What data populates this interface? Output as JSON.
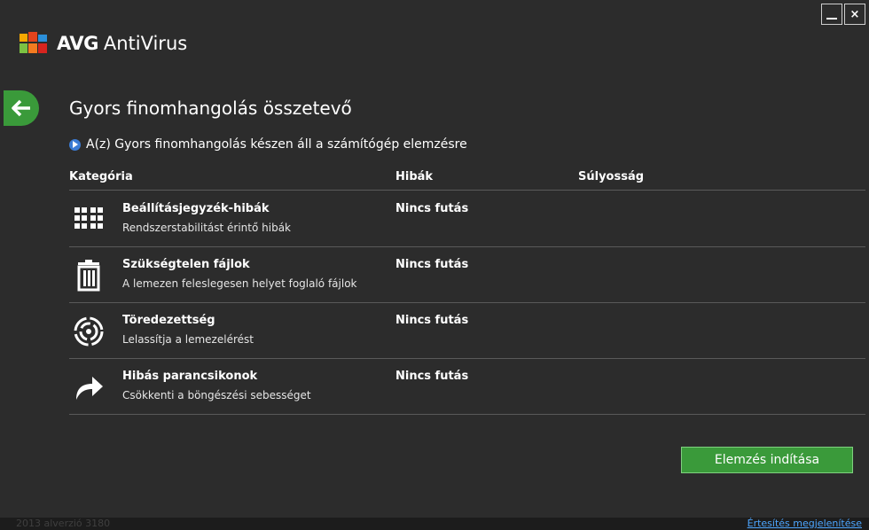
{
  "app": {
    "brand": "AVG",
    "product": "AntiVirus",
    "window_controls": {
      "minimize": "_",
      "close": "×"
    }
  },
  "page": {
    "title": "Gyors finomhangolás összetevő",
    "status": "A(z) Gyors finomhangolás készen áll a számítógép elemzésre"
  },
  "table": {
    "headers": {
      "category": "Kategória",
      "errors": "Hibák",
      "severity": "Súlyosság"
    },
    "rows": [
      {
        "icon": "registry-icon",
        "name": "Beállításjegyzék-hibák",
        "description": "Rendszerstabilitást érintő hibák",
        "errors": "Nincs futás"
      },
      {
        "icon": "trash-icon",
        "name": "Szükségtelen fájlok",
        "description": "A lemezen feleslegesen helyet foglaló fájlok",
        "errors": "Nincs futás"
      },
      {
        "icon": "fragmentation-icon",
        "name": "Töredezettség",
        "description": "Lelassítja a lemezelérést",
        "errors": "Nincs futás"
      },
      {
        "icon": "shortcut-arrow-icon",
        "name": "Hibás parancsikonok",
        "description": "Csökkenti a böngészési sebességet",
        "errors": "Nincs futás"
      }
    ]
  },
  "actions": {
    "start_scan": "Elemzés indítása"
  },
  "footer": {
    "version": "2013 alverzió 3180",
    "notification_link": "Értesítés megjelenítése"
  },
  "colors": {
    "background": "#2c2c2c",
    "accent_green": "#3a9a3a",
    "link_blue": "#4da6ff",
    "info_blue": "#3b7bd4"
  }
}
